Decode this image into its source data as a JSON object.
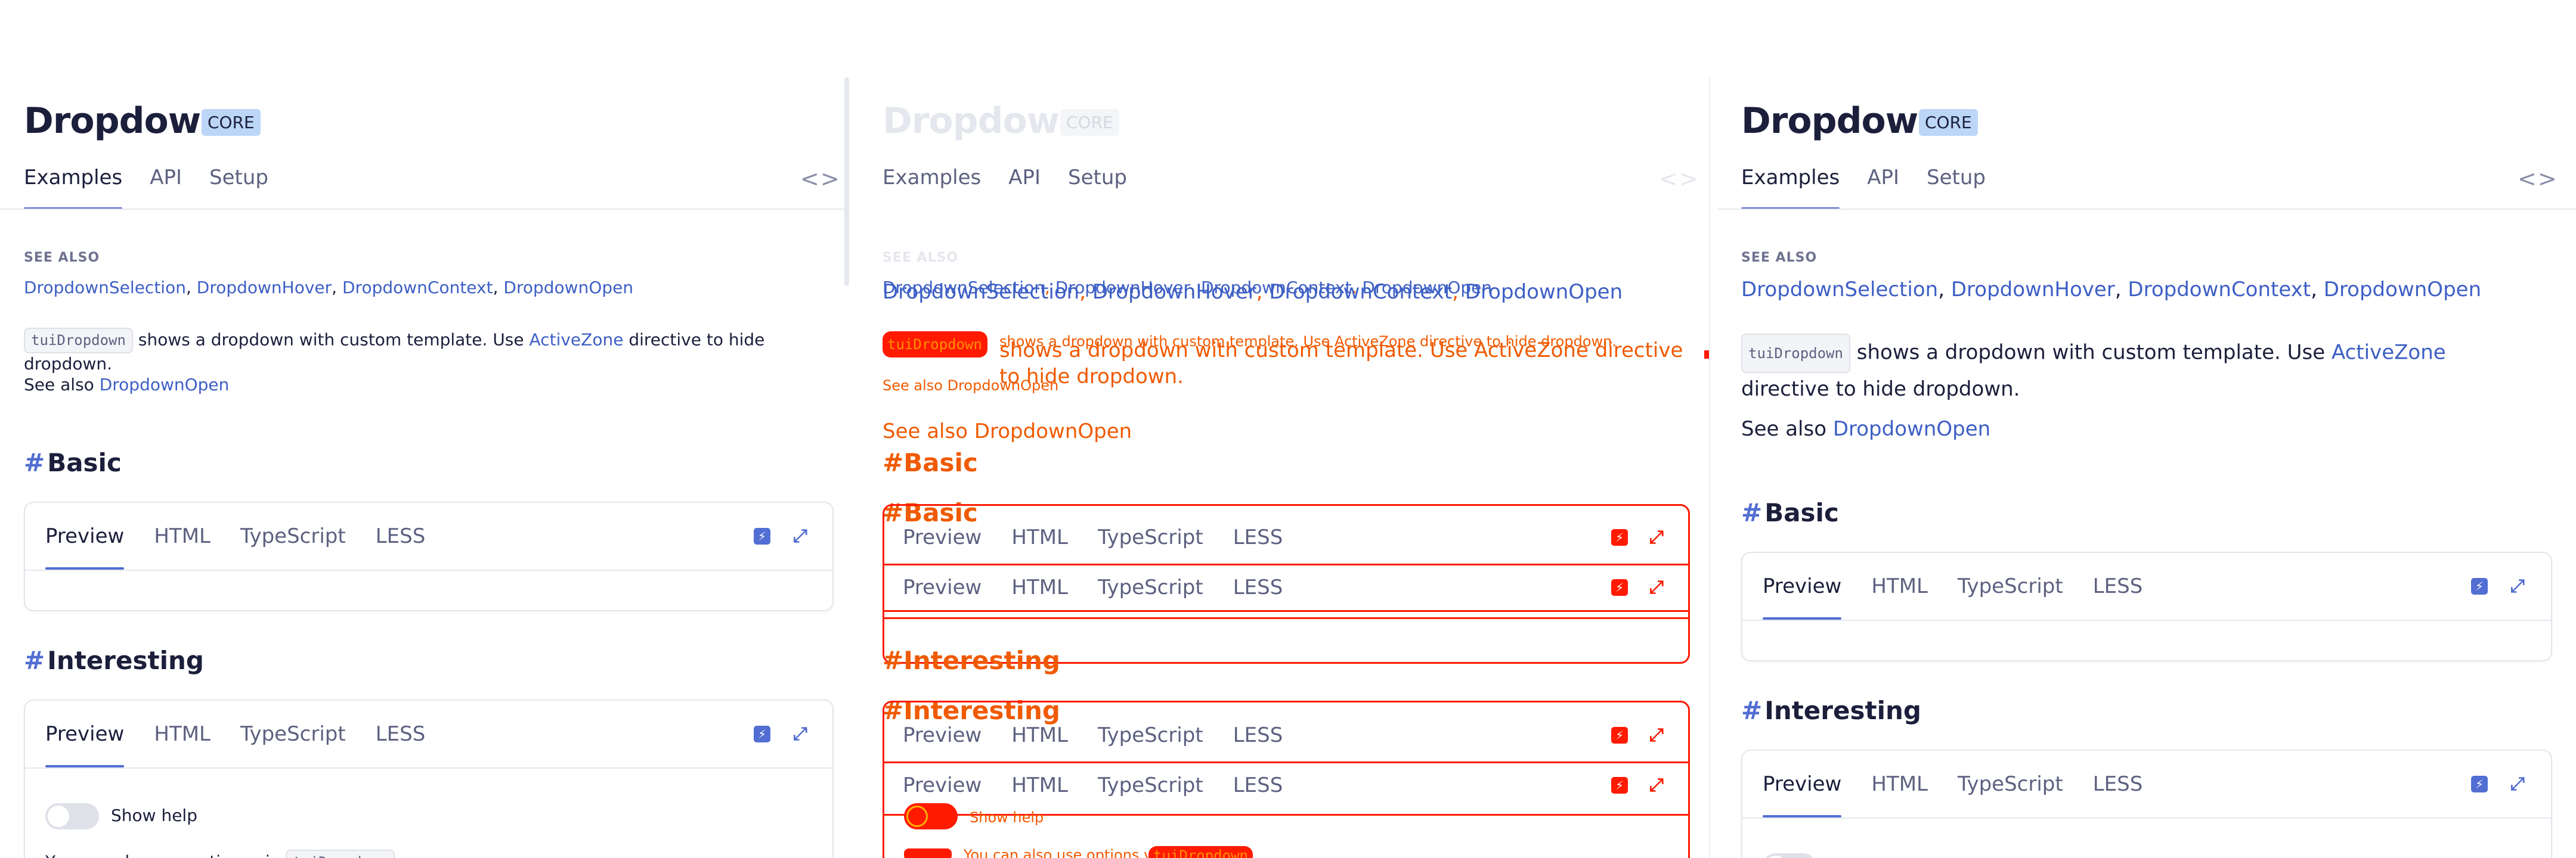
{
  "page": {
    "title": "Dropdown",
    "badge": "CORE",
    "tabs": [
      "Examples",
      "API",
      "Setup"
    ],
    "code_toggle": "<>",
    "see_also_label": "SEE ALSO",
    "see_also_links": [
      "DropdownSelection",
      "DropdownHover",
      "DropdownContext",
      "DropdownOpen"
    ],
    "desc_chip": "tuiDropdown",
    "desc_text_1": "shows a dropdown with custom template. Use",
    "desc_link": "ActiveZone",
    "desc_text_2": "directive to hide dropdown.",
    "see_also_prefix": "See also",
    "see_also_inline_link": "DropdownOpen",
    "sections": [
      {
        "hash": "#",
        "title": "Basic"
      },
      {
        "hash": "#",
        "title": "Interesting"
      }
    ],
    "demo_tabs": [
      "Preview",
      "HTML",
      "TypeScript",
      "LESS"
    ],
    "toggle_label": "Show help",
    "partial_text": "You can also use options via",
    "partial_chip": "tuiDropdown"
  },
  "colors": {
    "accent": "#526ed3",
    "link": "#3d5fc5",
    "badge_bg": "#bcd6f7",
    "glitch_red": "#ff1a00",
    "glitch_orange": "#f05a00"
  },
  "icons": {
    "demo_left": "stackblitz-bolt-icon",
    "demo_right": "expand-icon"
  }
}
